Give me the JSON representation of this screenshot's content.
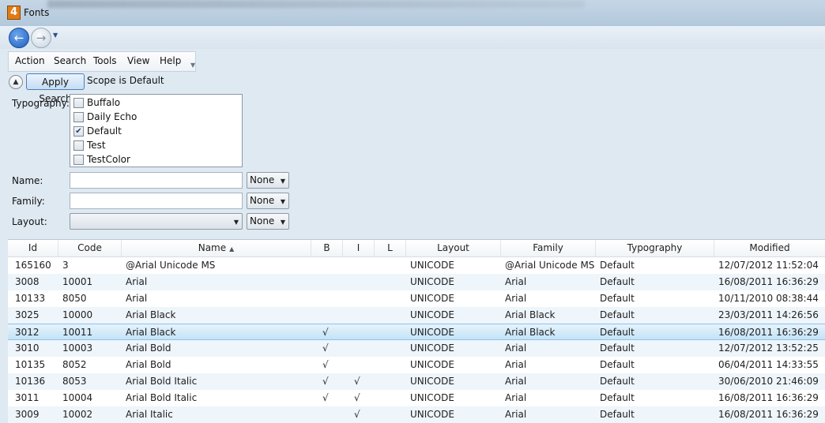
{
  "window": {
    "title": "Fonts",
    "app_icon_text": "4"
  },
  "menu": [
    "Action",
    "Search",
    "Tools",
    "View",
    "Help"
  ],
  "search": {
    "apply_label": "Apply Search",
    "scope_text": "Scope is Default",
    "typography_label": "Typography:",
    "typography_options": [
      {
        "label": "Buffalo",
        "checked": false
      },
      {
        "label": "Daily Echo",
        "checked": false
      },
      {
        "label": "Default",
        "checked": true
      },
      {
        "label": "Test",
        "checked": false
      },
      {
        "label": "TestColor",
        "checked": false
      }
    ],
    "name_label": "Name:",
    "name_value": "",
    "name_mode": "None",
    "family_label": "Family:",
    "family_value": "",
    "family_mode": "None",
    "layout_label": "Layout:",
    "layout_value": "",
    "layout_mode": "None"
  },
  "grid": {
    "columns": [
      "Id",
      "Code",
      "Name",
      "B",
      "I",
      "L",
      "Layout",
      "Family",
      "Typography",
      "Modified"
    ],
    "sorted_column": "Name",
    "check_glyph": "√",
    "selected_row_index": 4,
    "rows": [
      {
        "id": "165160",
        "code": "3",
        "name": "@Arial Unicode MS",
        "b": "",
        "i": "",
        "l": "",
        "layout": "UNICODE",
        "family": "@Arial Unicode MS",
        "typography": "Default",
        "modified": "12/07/2012 11:52:04"
      },
      {
        "id": "3008",
        "code": "10001",
        "name": "Arial",
        "b": "",
        "i": "",
        "l": "",
        "layout": "UNICODE",
        "family": "Arial",
        "typography": "Default",
        "modified": "16/08/2011 16:36:29"
      },
      {
        "id": "10133",
        "code": "8050",
        "name": "Arial",
        "b": "",
        "i": "",
        "l": "",
        "layout": "UNICODE",
        "family": "Arial",
        "typography": "Default",
        "modified": "10/11/2010 08:38:44"
      },
      {
        "id": "3025",
        "code": "10000",
        "name": "Arial Black",
        "b": "",
        "i": "",
        "l": "",
        "layout": "UNICODE",
        "family": "Arial Black",
        "typography": "Default",
        "modified": "23/03/2011 14:26:56"
      },
      {
        "id": "3012",
        "code": "10011",
        "name": "Arial Black",
        "b": "√",
        "i": "",
        "l": "",
        "layout": "UNICODE",
        "family": "Arial Black",
        "typography": "Default",
        "modified": "16/08/2011 16:36:29"
      },
      {
        "id": "3010",
        "code": "10003",
        "name": "Arial Bold",
        "b": "√",
        "i": "",
        "l": "",
        "layout": "UNICODE",
        "family": "Arial",
        "typography": "Default",
        "modified": "12/07/2012 13:52:25"
      },
      {
        "id": "10135",
        "code": "8052",
        "name": "Arial Bold",
        "b": "√",
        "i": "",
        "l": "",
        "layout": "UNICODE",
        "family": "Arial",
        "typography": "Default",
        "modified": "06/04/2011 14:33:55"
      },
      {
        "id": "10136",
        "code": "8053",
        "name": "Arial Bold Italic",
        "b": "√",
        "i": "√",
        "l": "",
        "layout": "UNICODE",
        "family": "Arial",
        "typography": "Default",
        "modified": "30/06/2010 21:46:09"
      },
      {
        "id": "3011",
        "code": "10004",
        "name": "Arial Bold Italic",
        "b": "√",
        "i": "√",
        "l": "",
        "layout": "UNICODE",
        "family": "Arial",
        "typography": "Default",
        "modified": "16/08/2011 16:36:29"
      },
      {
        "id": "3009",
        "code": "10002",
        "name": "Arial Italic",
        "b": "",
        "i": "√",
        "l": "",
        "layout": "UNICODE",
        "family": "Arial",
        "typography": "Default",
        "modified": "16/08/2011 16:36:29"
      }
    ]
  }
}
